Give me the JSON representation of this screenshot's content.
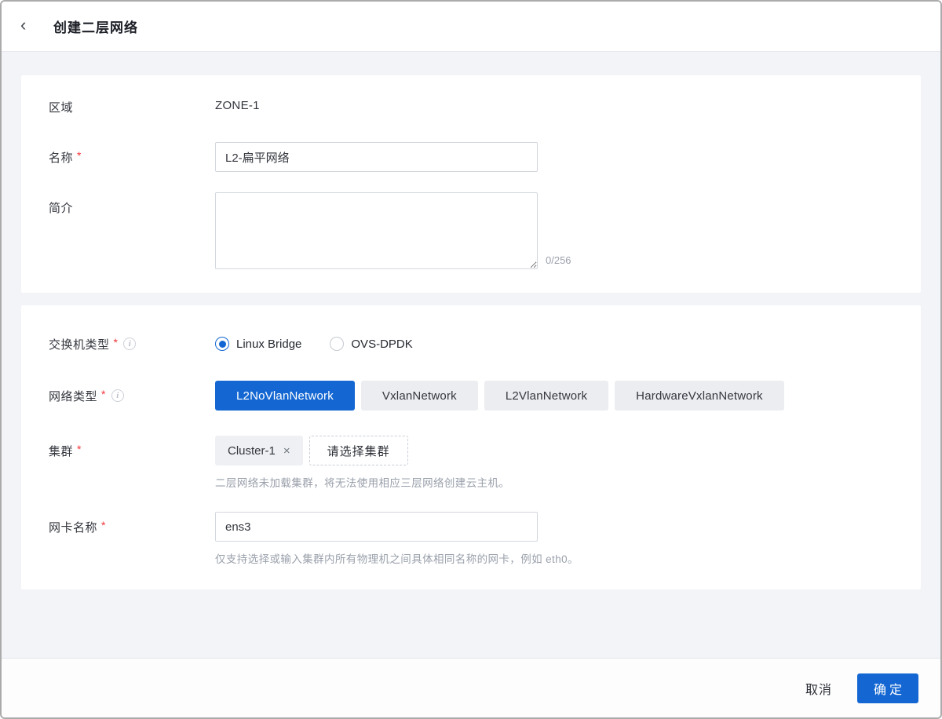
{
  "header": {
    "back_icon": "‹",
    "title": "创建二层网络"
  },
  "basic_form": {
    "zone": {
      "label": "区域",
      "value": "ZONE-1"
    },
    "name": {
      "label": "名称",
      "required_mark": "*",
      "value": "L2-扁平网络"
    },
    "description": {
      "label": "简介",
      "value": "",
      "counter": "0/256"
    }
  },
  "network_form": {
    "switch_type": {
      "label": "交换机类型",
      "required_mark": "*",
      "info_icon": "i",
      "options": [
        "Linux Bridge",
        "OVS-DPDK"
      ],
      "selected": "Linux Bridge"
    },
    "network_type": {
      "label": "网络类型",
      "required_mark": "*",
      "info_icon": "i",
      "options": [
        "L2NoVlanNetwork",
        "VxlanNetwork",
        "L2VlanNetwork",
        "HardwareVxlanNetwork"
      ],
      "selected": "L2NoVlanNetwork"
    },
    "cluster": {
      "label": "集群",
      "required_mark": "*",
      "tag_value": "Cluster-1",
      "tag_remove_icon": "×",
      "select_button": "请选择集群",
      "helper": "二层网络未加载集群，将无法使用相应三层网络创建云主机。"
    },
    "nic_name": {
      "label": "网卡名称",
      "required_mark": "*",
      "value": "ens3",
      "helper": "仅支持选择或输入集群内所有物理机之间具体相同名称的网卡，例如 eth0。"
    }
  },
  "footer": {
    "cancel_label": "取消",
    "confirm_label": "确定"
  },
  "colors": {
    "primary": "#1467d2",
    "page_background": "#f2f4f8",
    "card_background": "#ffffff",
    "segment_inactive": "#ecedf1",
    "required_red": "#f0343a",
    "helper_gray": "#9aa0ab"
  }
}
